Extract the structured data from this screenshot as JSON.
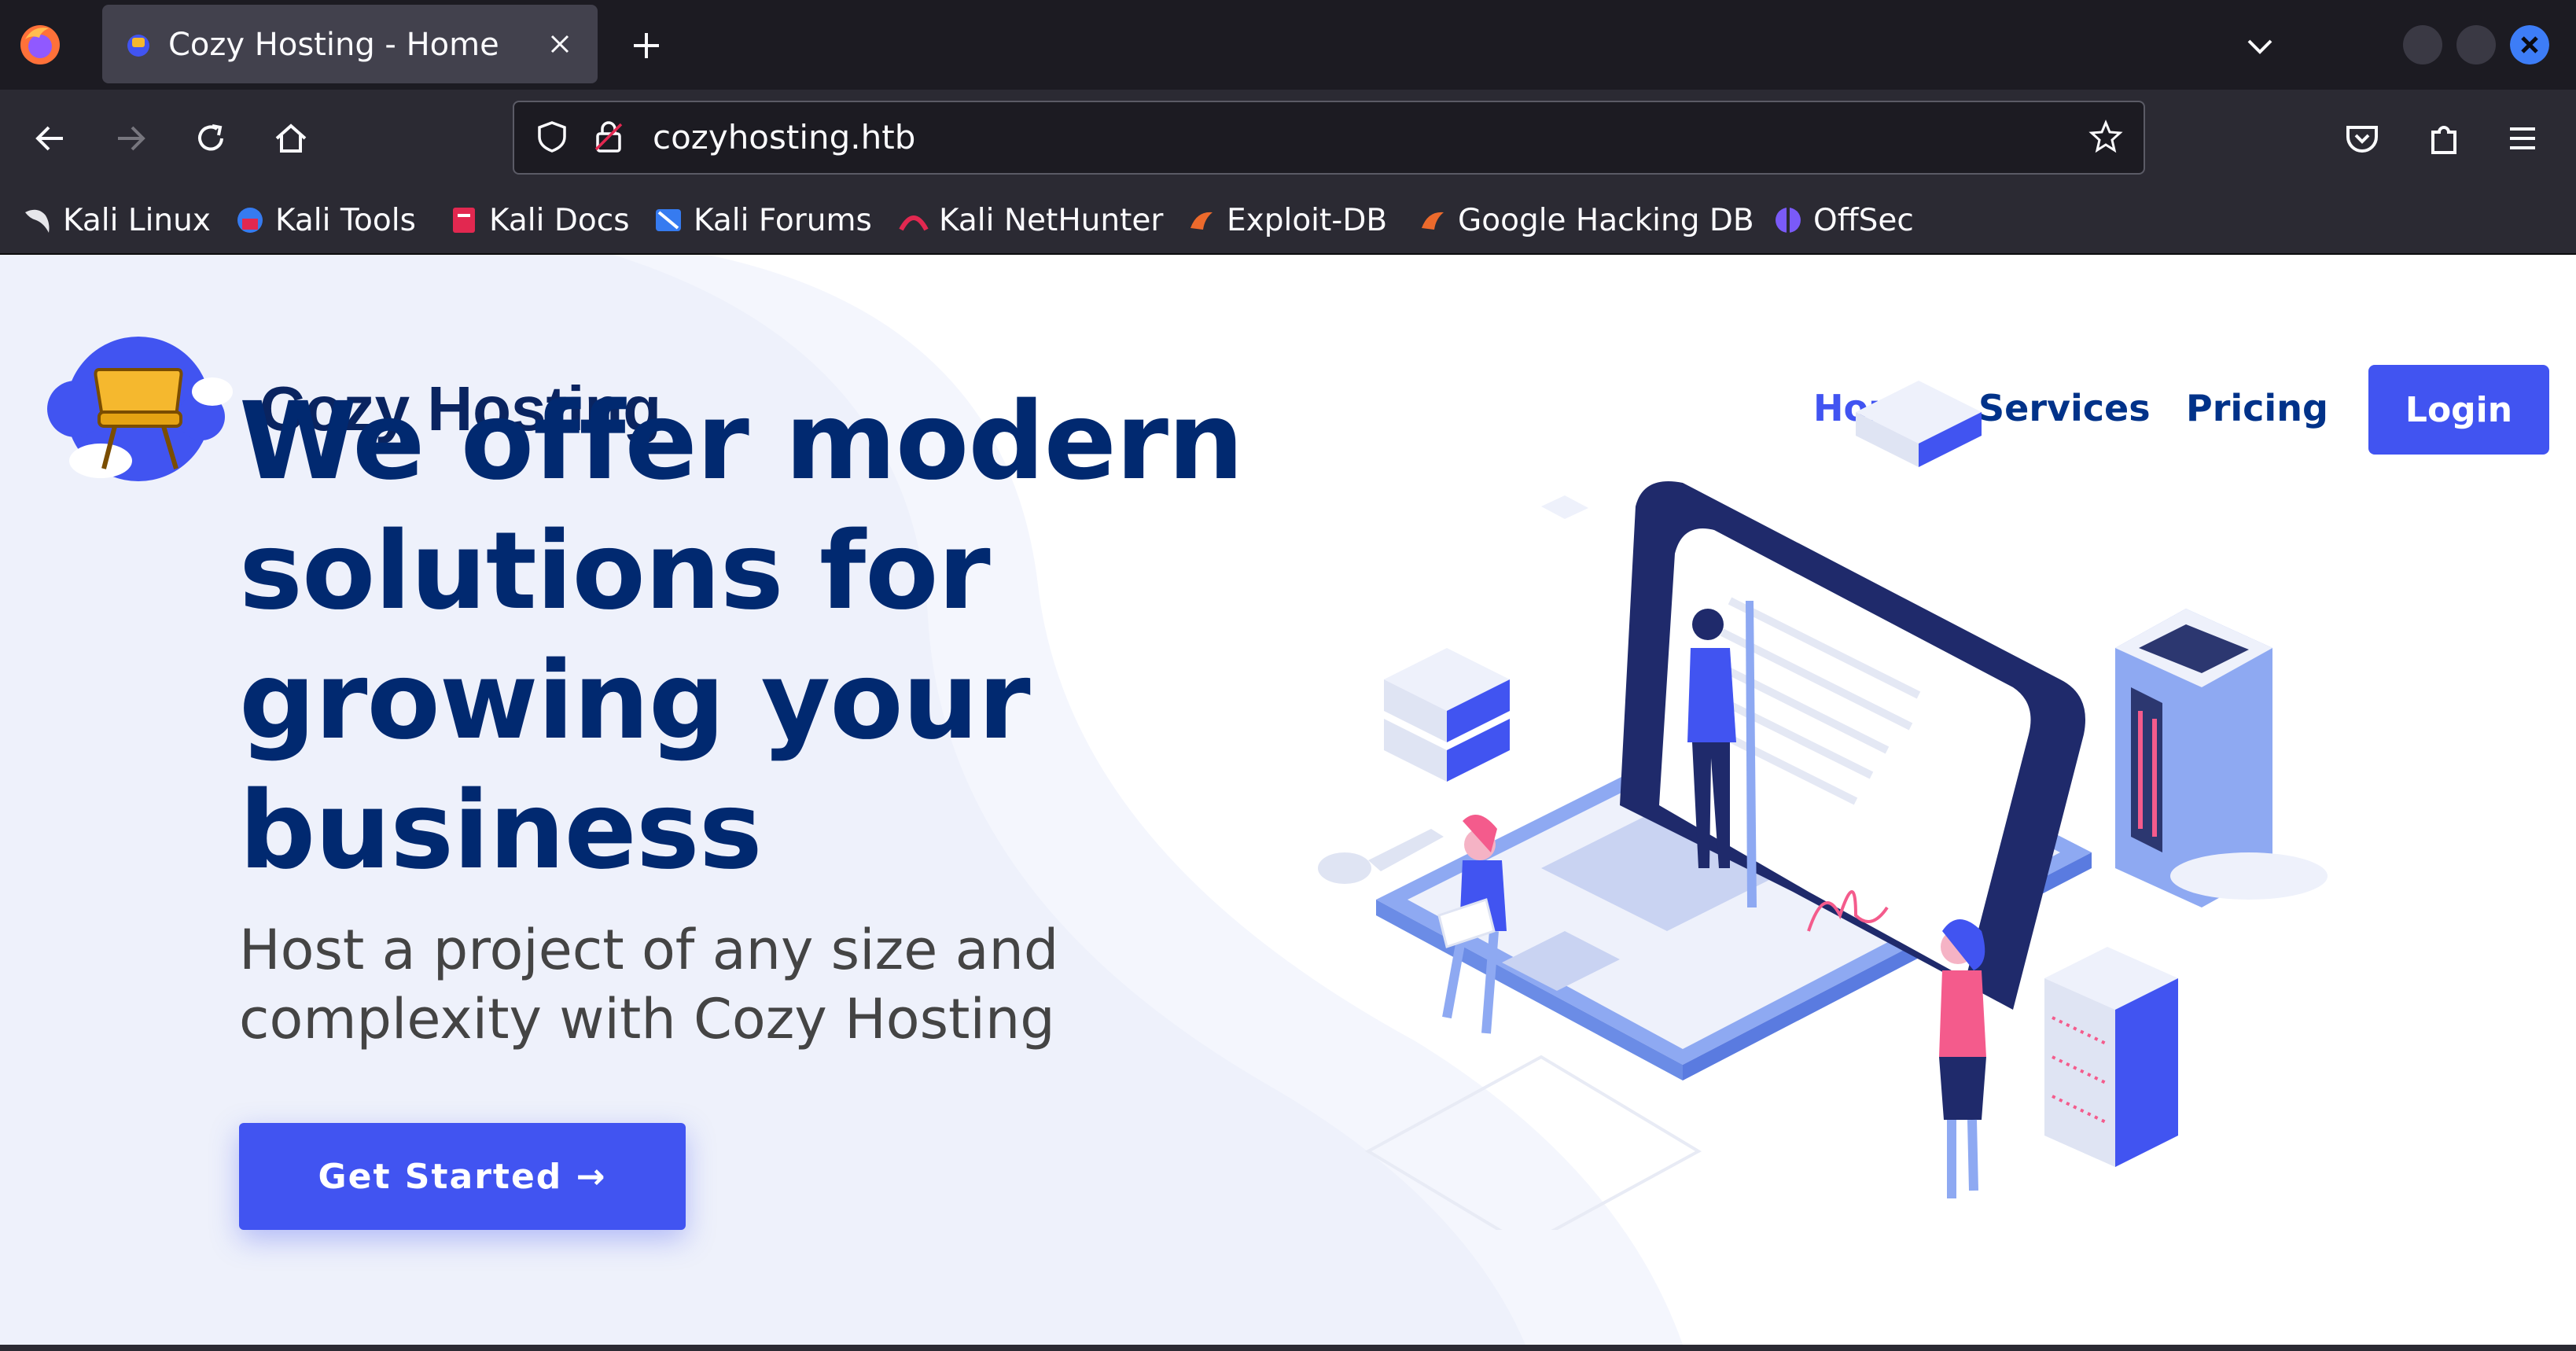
{
  "browser": {
    "tab": {
      "title": "Cozy Hosting - Home"
    },
    "url": "cozyhosting.htb",
    "bookmarks": [
      {
        "label": "Kali Linux",
        "icon": "kali-dragon-icon"
      },
      {
        "label": "Kali Tools",
        "icon": "kali-tools-icon"
      },
      {
        "label": "Kali Docs",
        "icon": "kali-docs-icon"
      },
      {
        "label": "Kali Forums",
        "icon": "kali-forums-icon"
      },
      {
        "label": "Kali NetHunter",
        "icon": "kali-nethunter-icon"
      },
      {
        "label": "Exploit-DB",
        "icon": "exploit-db-icon"
      },
      {
        "label": "Google Hacking DB",
        "icon": "ghdb-icon"
      },
      {
        "label": "OffSec",
        "icon": "offsec-icon"
      }
    ]
  },
  "site": {
    "logo_text": "Cozy Hosting",
    "nav": {
      "home": "Home",
      "services": "Services",
      "pricing": "Pricing",
      "login": "Login"
    },
    "hero": {
      "title": "We offer modern solutions for growing your business",
      "subtitle": "Host a project of any size and complexity with Cozy Hosting",
      "cta": "Get Started →"
    }
  },
  "colors": {
    "accent": "#4154f1",
    "heading": "#012970",
    "nav_active": "#4154f1",
    "nav_text": "#013289"
  }
}
